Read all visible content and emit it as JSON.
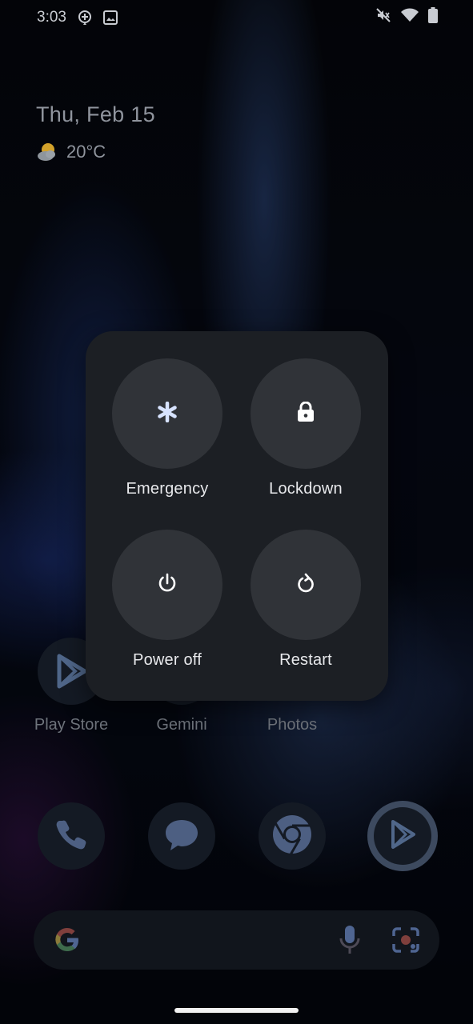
{
  "status_bar": {
    "time": "3:03",
    "icons_left": [
      "assistant-icon",
      "image-icon"
    ],
    "icons_right": [
      "silent-icon",
      "wifi-icon",
      "battery-icon"
    ]
  },
  "lock_info": {
    "date": "Thu, Feb 15",
    "temperature": "20°C",
    "weather_icon": "partly-cloudy-icon"
  },
  "apps": [
    {
      "label": "Play Store",
      "icon": "play-store-icon"
    },
    {
      "label": "Gemini",
      "icon": "gemini-icon"
    },
    {
      "label": "Photos",
      "icon": "photos-icon"
    }
  ],
  "dock": [
    {
      "icon": "phone-icon"
    },
    {
      "icon": "messages-icon"
    },
    {
      "icon": "chrome-icon"
    },
    {
      "icon": "play-store-icon"
    }
  ],
  "search": {
    "icons": [
      "google-logo-icon",
      "microphone-icon",
      "lens-icon"
    ]
  },
  "power_menu": {
    "items": [
      {
        "label": "Emergency",
        "icon": "asterisk-icon"
      },
      {
        "label": "Lockdown",
        "icon": "lock-icon"
      },
      {
        "label": "Power off",
        "icon": "power-icon"
      },
      {
        "label": "Restart",
        "icon": "restart-icon"
      }
    ]
  },
  "colors": {
    "menu_bg": "#1c1f24",
    "button_bg": "#303338",
    "emergency_icon": "#d7e3ff"
  }
}
